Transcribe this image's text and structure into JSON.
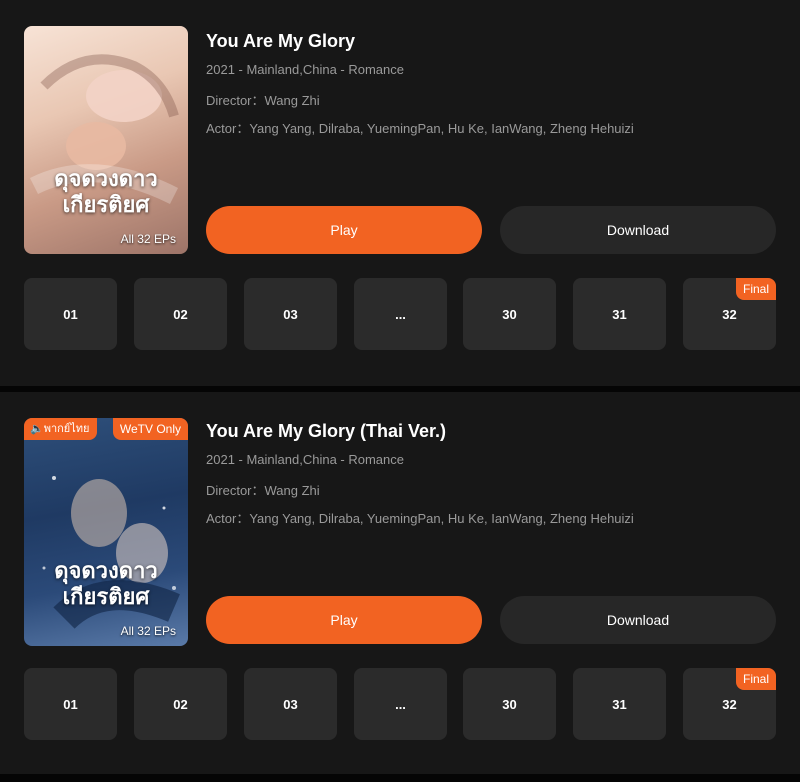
{
  "items": [
    {
      "title": "You Are My Glory",
      "meta_line": "2021 - Mainland,China - Romance",
      "director": "Director：Wang Zhi",
      "actors": "Actor：Yang Yang, Dilraba, YuemingPan, Hu Ke, IanWang, Zheng Hehuizi",
      "poster_title": "ดุจดวงดาว เกียรติยศ",
      "poster_eps": "All 32 EPs",
      "play_label": "Play",
      "download_label": "Download",
      "episodes": [
        "01",
        "02",
        "03",
        "...",
        "30",
        "31",
        "32"
      ],
      "final_badge": "Final"
    },
    {
      "title": "You Are My Glory (Thai Ver.)",
      "meta_line": "2021 - Mainland,China - Romance",
      "director": "Director：Wang Zhi",
      "actors": "Actor：Yang Yang, Dilraba, YuemingPan, Hu Ke, IanWang, Zheng Hehuizi",
      "poster_title": "ดุจดวงดาว เกียรติยศ",
      "poster_eps": "All 32 EPs",
      "badge_left": "พากย์ไทย",
      "badge_right": "WeTV Only",
      "play_label": "Play",
      "download_label": "Download",
      "episodes": [
        "01",
        "02",
        "03",
        "...",
        "30",
        "31",
        "32"
      ],
      "final_badge": "Final"
    }
  ],
  "colors": {
    "accent": "#f26322",
    "card_bg": "#171717",
    "tile_bg": "#2b2b2b",
    "secondary_button": "#272727",
    "muted_text": "#9a9a9a"
  }
}
